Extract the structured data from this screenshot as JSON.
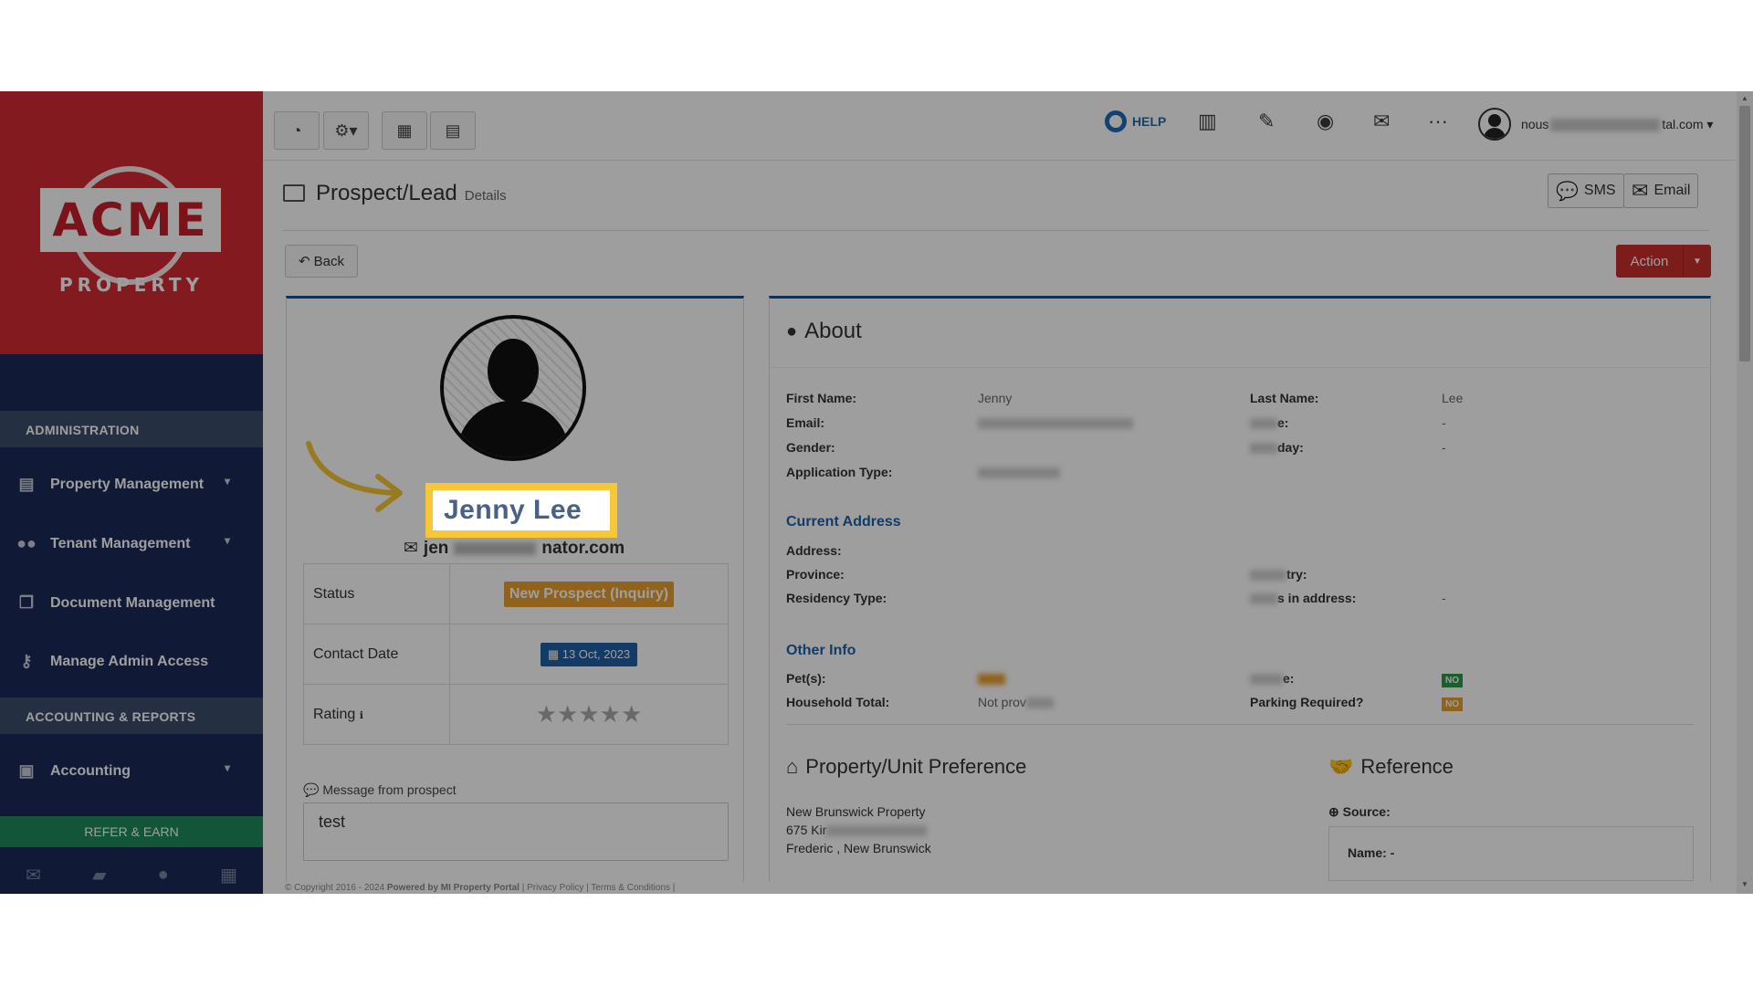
{
  "sidebar": {
    "logo_text": "ACME",
    "logo_sub": "PROPERTY",
    "section_admin": "ADMINISTRATION",
    "items": [
      {
        "label": "Property Management",
        "icon": "building-icon"
      },
      {
        "label": "Tenant Management",
        "icon": "users-icon"
      },
      {
        "label": "Document Management",
        "icon": "documents-icon"
      },
      {
        "label": "Manage Admin Access",
        "icon": "key-icon"
      }
    ],
    "section_accounting": "ACCOUNTING & REPORTS",
    "accounting_label": "Accounting",
    "refer_label": "REFER & EARN"
  },
  "topbar": {
    "help_label": "HELP",
    "user_email_start": "nous",
    "user_email_end": "tal.com"
  },
  "page": {
    "title": "Prospect/Lead",
    "subtitle": "Details",
    "sms_label": "SMS",
    "email_label": "Email",
    "back_label": "Back",
    "action_label": "Action"
  },
  "prospect": {
    "name": "Jenny Lee",
    "email_start": "jen",
    "email_end": "nator.com",
    "status_label": "Status",
    "status_value": "New Prospect (Inquiry)",
    "contact_label": "Contact Date",
    "contact_value": "13 Oct, 2023",
    "rating_label": "Rating",
    "message_label": "Message from prospect",
    "message_value": "test"
  },
  "about": {
    "title": "About",
    "first_name_label": "First Name:",
    "first_name": "Jenny",
    "last_name_label": "Last Name:",
    "last_name": "Lee",
    "email_label": "Email:",
    "phone_label_end": "e:",
    "phone_value": "-",
    "gender_label": "Gender:",
    "birthday_label_end": "day:",
    "birthday_value": "-",
    "app_type_label": "Application Type:",
    "current_address_title": "Current Address",
    "address_label": "Address:",
    "province_label": "Province:",
    "country_label_end": "try:",
    "residency_label": "Residency Type:",
    "years_label_end": "s in address:",
    "years_value": "-",
    "other_info_title": "Other Info",
    "pets_label": "Pet(s):",
    "smoke_label_end": "e:",
    "smoke_value": "NO",
    "household_label": "Household Total:",
    "household_value": "Not prov",
    "parking_label": "Parking Required?",
    "parking_value": "NO"
  },
  "preference": {
    "title": "Property/Unit Preference",
    "line1": "New Brunswick Property",
    "line2": "675 Kir",
    "line3": "Frederic     , New Brunswick"
  },
  "reference": {
    "title": "Reference",
    "source_label": "Source:",
    "name_label": "Name: -"
  },
  "footer": {
    "copyright": "© Copyright 2016 - 2024",
    "powered": "Powered by MI Property Portal",
    "links": "| Privacy Policy | Terms & Conditions |"
  }
}
